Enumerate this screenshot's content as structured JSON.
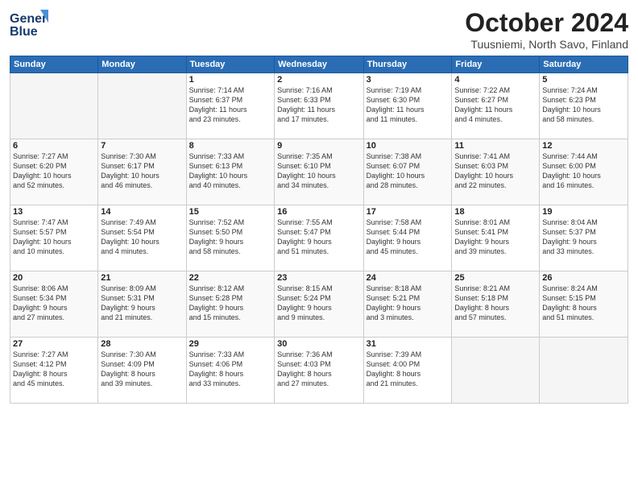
{
  "logo": {
    "line1": "General",
    "line2": "Blue"
  },
  "header": {
    "month": "October 2024",
    "location": "Tuusniemi, North Savo, Finland"
  },
  "weekdays": [
    "Sunday",
    "Monday",
    "Tuesday",
    "Wednesday",
    "Thursday",
    "Friday",
    "Saturday"
  ],
  "weeks": [
    [
      {
        "day": "",
        "info": ""
      },
      {
        "day": "",
        "info": ""
      },
      {
        "day": "1",
        "info": "Sunrise: 7:14 AM\nSunset: 6:37 PM\nDaylight: 11 hours\nand 23 minutes."
      },
      {
        "day": "2",
        "info": "Sunrise: 7:16 AM\nSunset: 6:33 PM\nDaylight: 11 hours\nand 17 minutes."
      },
      {
        "day": "3",
        "info": "Sunrise: 7:19 AM\nSunset: 6:30 PM\nDaylight: 11 hours\nand 11 minutes."
      },
      {
        "day": "4",
        "info": "Sunrise: 7:22 AM\nSunset: 6:27 PM\nDaylight: 11 hours\nand 4 minutes."
      },
      {
        "day": "5",
        "info": "Sunrise: 7:24 AM\nSunset: 6:23 PM\nDaylight: 10 hours\nand 58 minutes."
      }
    ],
    [
      {
        "day": "6",
        "info": "Sunrise: 7:27 AM\nSunset: 6:20 PM\nDaylight: 10 hours\nand 52 minutes."
      },
      {
        "day": "7",
        "info": "Sunrise: 7:30 AM\nSunset: 6:17 PM\nDaylight: 10 hours\nand 46 minutes."
      },
      {
        "day": "8",
        "info": "Sunrise: 7:33 AM\nSunset: 6:13 PM\nDaylight: 10 hours\nand 40 minutes."
      },
      {
        "day": "9",
        "info": "Sunrise: 7:35 AM\nSunset: 6:10 PM\nDaylight: 10 hours\nand 34 minutes."
      },
      {
        "day": "10",
        "info": "Sunrise: 7:38 AM\nSunset: 6:07 PM\nDaylight: 10 hours\nand 28 minutes."
      },
      {
        "day": "11",
        "info": "Sunrise: 7:41 AM\nSunset: 6:03 PM\nDaylight: 10 hours\nand 22 minutes."
      },
      {
        "day": "12",
        "info": "Sunrise: 7:44 AM\nSunset: 6:00 PM\nDaylight: 10 hours\nand 16 minutes."
      }
    ],
    [
      {
        "day": "13",
        "info": "Sunrise: 7:47 AM\nSunset: 5:57 PM\nDaylight: 10 hours\nand 10 minutes."
      },
      {
        "day": "14",
        "info": "Sunrise: 7:49 AM\nSunset: 5:54 PM\nDaylight: 10 hours\nand 4 minutes."
      },
      {
        "day": "15",
        "info": "Sunrise: 7:52 AM\nSunset: 5:50 PM\nDaylight: 9 hours\nand 58 minutes."
      },
      {
        "day": "16",
        "info": "Sunrise: 7:55 AM\nSunset: 5:47 PM\nDaylight: 9 hours\nand 51 minutes."
      },
      {
        "day": "17",
        "info": "Sunrise: 7:58 AM\nSunset: 5:44 PM\nDaylight: 9 hours\nand 45 minutes."
      },
      {
        "day": "18",
        "info": "Sunrise: 8:01 AM\nSunset: 5:41 PM\nDaylight: 9 hours\nand 39 minutes."
      },
      {
        "day": "19",
        "info": "Sunrise: 8:04 AM\nSunset: 5:37 PM\nDaylight: 9 hours\nand 33 minutes."
      }
    ],
    [
      {
        "day": "20",
        "info": "Sunrise: 8:06 AM\nSunset: 5:34 PM\nDaylight: 9 hours\nand 27 minutes."
      },
      {
        "day": "21",
        "info": "Sunrise: 8:09 AM\nSunset: 5:31 PM\nDaylight: 9 hours\nand 21 minutes."
      },
      {
        "day": "22",
        "info": "Sunrise: 8:12 AM\nSunset: 5:28 PM\nDaylight: 9 hours\nand 15 minutes."
      },
      {
        "day": "23",
        "info": "Sunrise: 8:15 AM\nSunset: 5:24 PM\nDaylight: 9 hours\nand 9 minutes."
      },
      {
        "day": "24",
        "info": "Sunrise: 8:18 AM\nSunset: 5:21 PM\nDaylight: 9 hours\nand 3 minutes."
      },
      {
        "day": "25",
        "info": "Sunrise: 8:21 AM\nSunset: 5:18 PM\nDaylight: 8 hours\nand 57 minutes."
      },
      {
        "day": "26",
        "info": "Sunrise: 8:24 AM\nSunset: 5:15 PM\nDaylight: 8 hours\nand 51 minutes."
      }
    ],
    [
      {
        "day": "27",
        "info": "Sunrise: 7:27 AM\nSunset: 4:12 PM\nDaylight: 8 hours\nand 45 minutes."
      },
      {
        "day": "28",
        "info": "Sunrise: 7:30 AM\nSunset: 4:09 PM\nDaylight: 8 hours\nand 39 minutes."
      },
      {
        "day": "29",
        "info": "Sunrise: 7:33 AM\nSunset: 4:06 PM\nDaylight: 8 hours\nand 33 minutes."
      },
      {
        "day": "30",
        "info": "Sunrise: 7:36 AM\nSunset: 4:03 PM\nDaylight: 8 hours\nand 27 minutes."
      },
      {
        "day": "31",
        "info": "Sunrise: 7:39 AM\nSunset: 4:00 PM\nDaylight: 8 hours\nand 21 minutes."
      },
      {
        "day": "",
        "info": ""
      },
      {
        "day": "",
        "info": ""
      }
    ]
  ]
}
